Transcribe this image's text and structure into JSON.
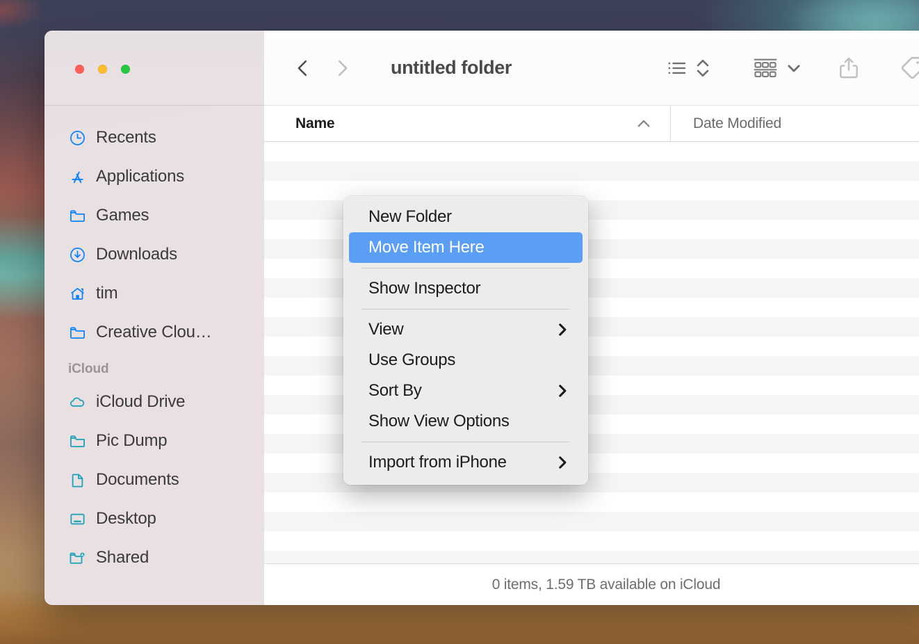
{
  "window": {
    "title": "untitled folder",
    "traffic_lights": [
      {
        "name": "close",
        "color": "#ff5f57"
      },
      {
        "name": "minimize",
        "color": "#febc2e"
      },
      {
        "name": "maximize",
        "color": "#28c840"
      }
    ]
  },
  "toolbar": {
    "back_icon": "chevron-left-icon",
    "forward_icon": "chevron-right-icon",
    "view_list_icon": "list-view-icon",
    "view_sort_icon": "up-down-chevrons-icon",
    "group_icon": "group-by-icon",
    "group_dropdown_icon": "chevron-down-icon",
    "share_icon": "share-icon",
    "tag_icon": "tag-icon"
  },
  "columns": {
    "name": "Name",
    "name_sort_icon": "chevron-up-icon",
    "date_modified": "Date Modified"
  },
  "file_list": {
    "rows": []
  },
  "status": {
    "text": "0 items, 1.59 TB available on iCloud"
  },
  "sidebar": {
    "favorites": [
      {
        "label": "Recents",
        "icon": "clock-icon",
        "color": "#0a84ff"
      },
      {
        "label": "Applications",
        "icon": "app-store-icon",
        "color": "#0a84ff"
      },
      {
        "label": "Games",
        "icon": "folder-icon",
        "color": "#0a84ff"
      },
      {
        "label": "Downloads",
        "icon": "download-icon",
        "color": "#0a84ff"
      },
      {
        "label": "tim",
        "icon": "home-icon",
        "color": "#0a84ff"
      },
      {
        "label": "Creative Clou…",
        "icon": "folder-icon",
        "color": "#0a84ff"
      }
    ],
    "icloud_header": "iCloud",
    "icloud": [
      {
        "label": "iCloud Drive",
        "icon": "cloud-icon",
        "color": "#17a2b8"
      },
      {
        "label": "Pic Dump",
        "icon": "folder-icon",
        "color": "#17a2b8"
      },
      {
        "label": "Documents",
        "icon": "document-icon",
        "color": "#17a2b8"
      },
      {
        "label": "Desktop",
        "icon": "desktop-icon",
        "color": "#17a2b8"
      },
      {
        "label": "Shared",
        "icon": "shared-folder-icon",
        "color": "#17a2b8"
      }
    ]
  },
  "context_menu": {
    "highlight_color": "#5a9ef6",
    "groups": [
      [
        {
          "label": "New Folder",
          "submenu": false,
          "selected": false
        },
        {
          "label": "Move Item Here",
          "submenu": false,
          "selected": true
        }
      ],
      [
        {
          "label": "Show Inspector",
          "submenu": false,
          "selected": false
        }
      ],
      [
        {
          "label": "View",
          "submenu": true,
          "selected": false
        },
        {
          "label": "Use Groups",
          "submenu": false,
          "selected": false
        },
        {
          "label": "Sort By",
          "submenu": true,
          "selected": false
        },
        {
          "label": "Show View Options",
          "submenu": false,
          "selected": false
        }
      ],
      [
        {
          "label": "Import from iPhone",
          "submenu": true,
          "selected": false
        }
      ]
    ]
  }
}
